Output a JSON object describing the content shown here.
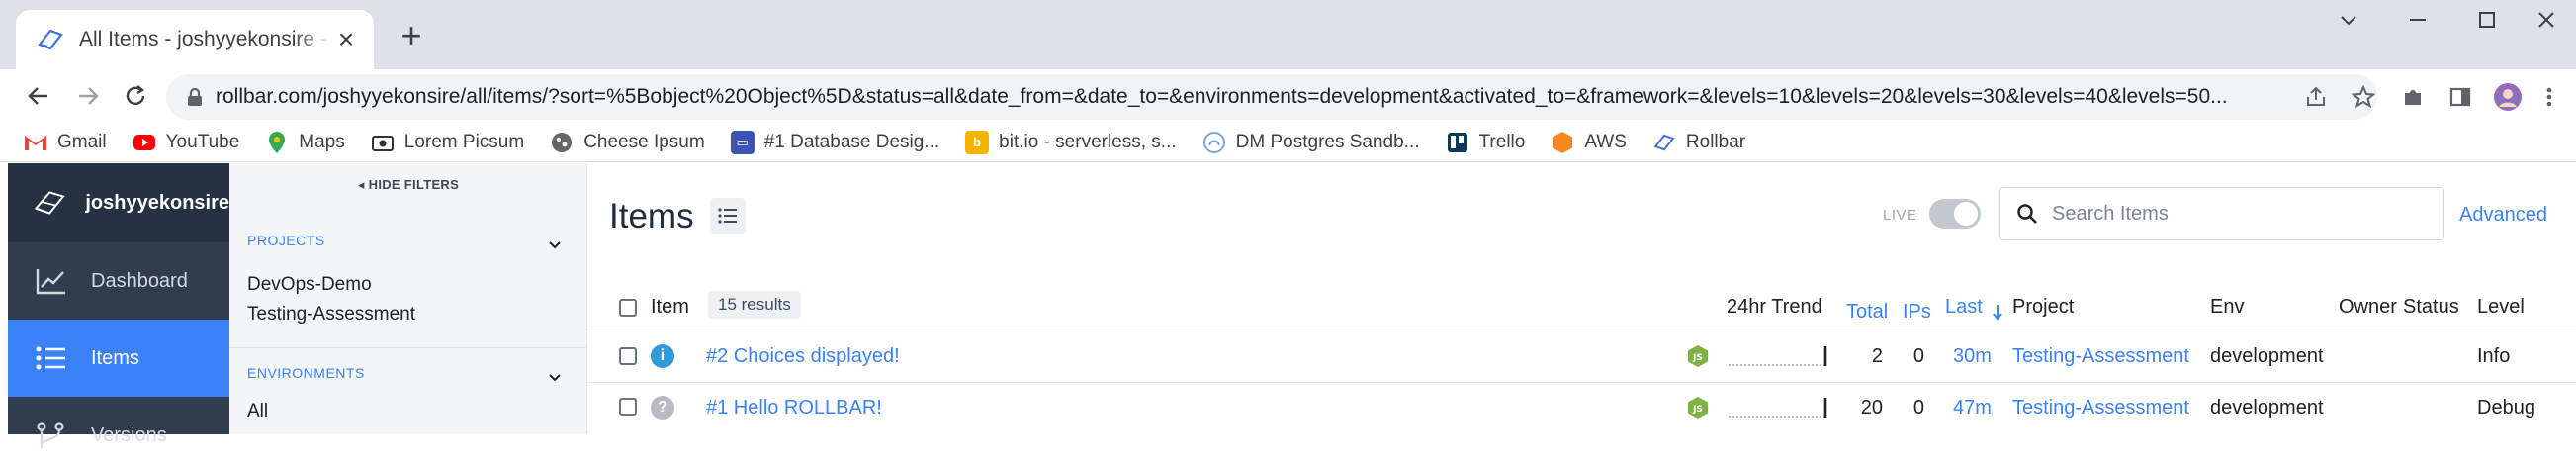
{
  "browser": {
    "tab_title": "All Items - joshyyekonsire - Rollbar",
    "url": "rollbar.com/joshyyekonsire/all/items/?sort=%5Bobject%20Object%5D&status=all&date_from=&date_to=&environments=development&activated_to=&framework=&levels=10&levels=20&levels=30&levels=40&levels=50...",
    "bookmarks": [
      {
        "label": "Gmail",
        "icon": "gmail-icon",
        "color": "#ea4335"
      },
      {
        "label": "YouTube",
        "icon": "youtube-icon",
        "color": "#ff0000"
      },
      {
        "label": "Maps",
        "icon": "maps-icon",
        "color": "#34a853"
      },
      {
        "label": "Lorem Picsum",
        "icon": "picture-icon",
        "color": "#555555"
      },
      {
        "label": "Cheese Ipsum",
        "icon": "cheese-icon",
        "color": "#555555"
      },
      {
        "label": "#1 Database Desig...",
        "icon": "database-icon",
        "color": "#3f51b5"
      },
      {
        "label": "bit.io - serverless, s...",
        "icon": "bitio-icon",
        "color": "#f5b400"
      },
      {
        "label": "DM Postgres Sandb...",
        "icon": "postgres-icon",
        "color": "#7aa7e0"
      },
      {
        "label": "Trello",
        "icon": "trello-icon",
        "color": "#0c3953"
      },
      {
        "label": "AWS",
        "icon": "aws-icon",
        "color": "#f7881f"
      },
      {
        "label": "Rollbar",
        "icon": "rollbar-icon",
        "color": "#3b6fd6"
      }
    ]
  },
  "sidebar": {
    "org_name": "joshyyekonsire",
    "items": [
      {
        "label": "Dashboard",
        "icon": "chart-line-icon",
        "active": false
      },
      {
        "label": "Items",
        "icon": "list-icon",
        "active": true
      },
      {
        "label": "Versions",
        "icon": "branch-icon",
        "active": false
      }
    ]
  },
  "filters": {
    "hide_label": "HIDE FILTERS",
    "projects": {
      "label": "PROJECTS",
      "values": [
        "DevOps-Demo",
        "Testing-Assessment"
      ]
    },
    "environments": {
      "label": "ENVIRONMENTS",
      "values": [
        "All"
      ]
    }
  },
  "main": {
    "title": "Items",
    "live_label": "LIVE",
    "live_on": false,
    "search_placeholder": "Search Items",
    "advanced_label": "Advanced",
    "results_badge": "15 results",
    "columns": {
      "item": "Item",
      "trend": "24hr Trend",
      "total": "Total",
      "ips": "IPs",
      "last": "Last",
      "project": "Project",
      "env": "Env",
      "owner": "Owner",
      "status": "Status",
      "level": "Level"
    },
    "rows": [
      {
        "level_icon": "info-icon",
        "level_color": "#2e9bd6",
        "level_glyph": "i",
        "title": "#2 Choices displayed!",
        "framework_icon": "nodejs-icon",
        "total": "2",
        "ips": "0",
        "last": "30m",
        "project": "Testing-Assessment",
        "env": "development",
        "owner": "",
        "status": "",
        "level": "Info"
      },
      {
        "level_icon": "question-icon",
        "level_color": "#b8bcc2",
        "level_glyph": "?",
        "title": "#1 Hello ROLLBAR!",
        "framework_icon": "nodejs-icon",
        "total": "20",
        "ips": "0",
        "last": "47m",
        "project": "Testing-Assessment",
        "env": "development",
        "owner": "",
        "status": "",
        "level": "Debug"
      }
    ]
  },
  "colors": {
    "accent": "#3b82f6",
    "sidebar": "#2f3d4e",
    "sidebar_active": "#3b82f6",
    "nodejs": "#7cb342"
  }
}
